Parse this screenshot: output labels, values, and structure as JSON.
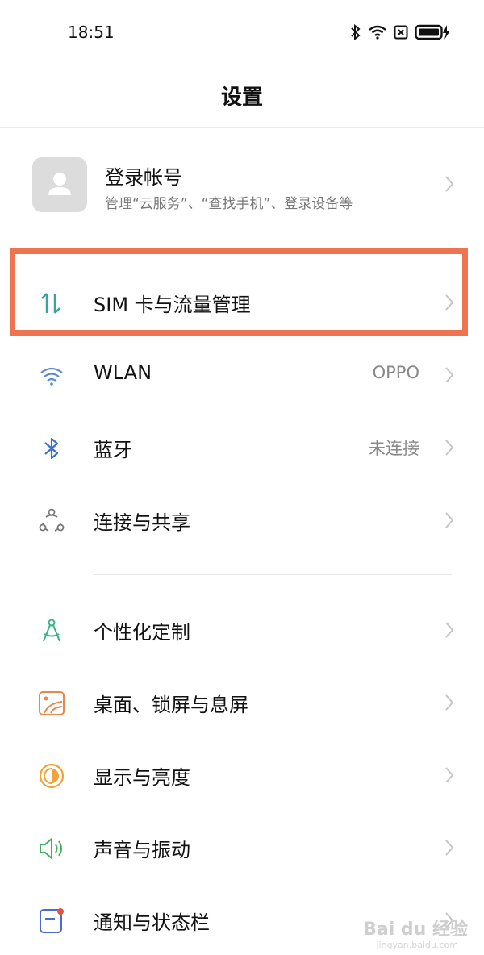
{
  "status_bar": {
    "time": "18:51"
  },
  "header": {
    "title": "设置"
  },
  "account": {
    "title": "登录帐号",
    "subtitle": "管理“云服务”、“查找手机”、登录设备等"
  },
  "items": [
    {
      "label": "SIM 卡与流量管理",
      "value": ""
    },
    {
      "label": "WLAN",
      "value": "OPPO"
    },
    {
      "label": "蓝牙",
      "value": "未连接"
    },
    {
      "label": "连接与共享",
      "value": ""
    },
    {
      "label": "个性化定制",
      "value": ""
    },
    {
      "label": "桌面、锁屏与息屏",
      "value": ""
    },
    {
      "label": "显示与亮度",
      "value": ""
    },
    {
      "label": "声音与振动",
      "value": ""
    },
    {
      "label": "通知与状态栏",
      "value": ""
    }
  ],
  "watermark": {
    "text": "Bai du 经验",
    "sub": "jingyan.baidu.com"
  },
  "colors": {
    "highlight": "#ee7450",
    "sim_icon": "#3aa39a",
    "wlan_icon": "#5a8bd6",
    "bluetooth_icon": "#3f6fc8",
    "personalize_icon": "#3fb087",
    "desktop_icon": "#e58a4a",
    "display_icon": "#f2a23c",
    "sound_icon": "#43b05c",
    "notification_icon": "#4a6bd0"
  }
}
